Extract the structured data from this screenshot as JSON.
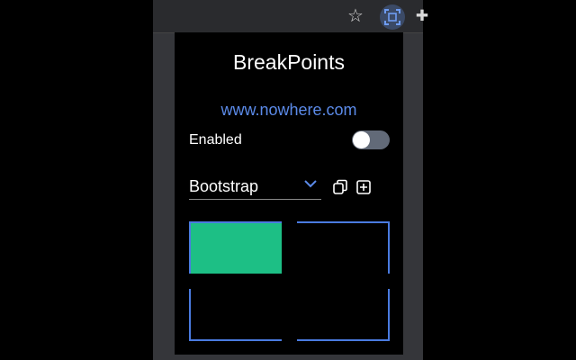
{
  "popup": {
    "title": "BreakPoints",
    "site": "www.nowhere.com",
    "enabled_label": "Enabled",
    "enabled": false,
    "framework": "Bootstrap"
  },
  "icons": {
    "toolbar": [
      "star-icon",
      "breakpoints-extension-icon",
      "puzzle-icon"
    ],
    "popup": [
      "chevron-down-icon",
      "copy-icon",
      "add-icon"
    ]
  },
  "colors": {
    "accent": "#5b8ae8",
    "active_breakpoint": "#1dbf85",
    "breakpoint_border": "#4a7be0",
    "toggle_off": "#626a78"
  },
  "breakpoints": {
    "active_index": 0,
    "count": 4
  }
}
